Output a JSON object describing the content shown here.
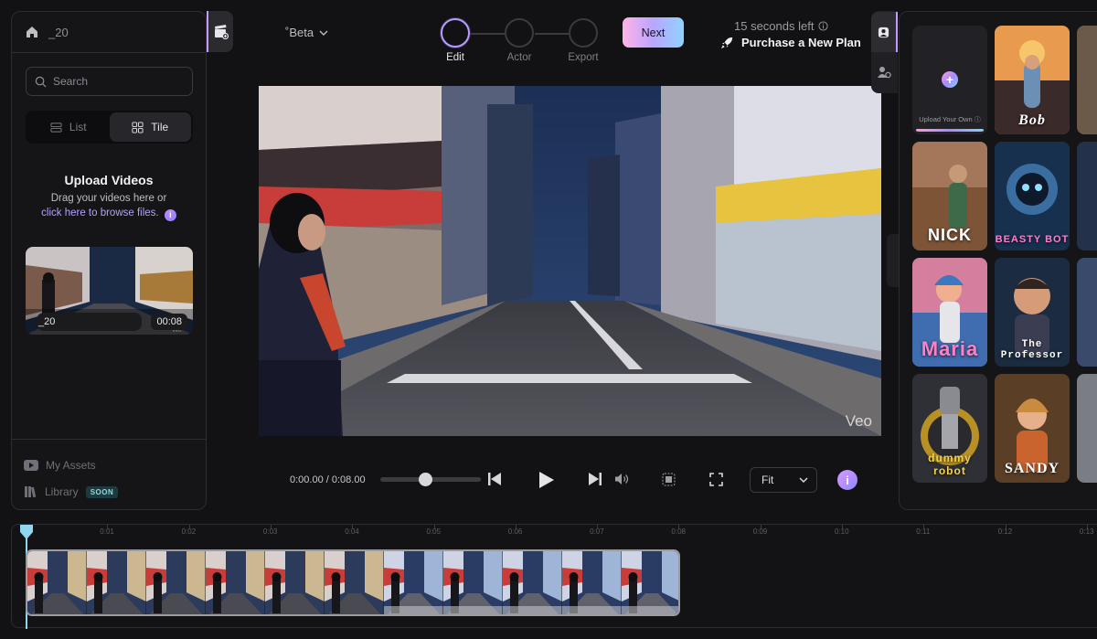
{
  "project": {
    "name": "_20",
    "version": "˚Beta"
  },
  "left_panel": {
    "search_placeholder": "Search",
    "view_list": "List",
    "view_tile": "Tile",
    "upload_title": "Upload Videos",
    "upload_line1": "Drag your videos here or",
    "upload_link": "click here to browse files.",
    "info_glyph": "i",
    "video": {
      "name": "_20",
      "duration": "00:08",
      "watermark": "Veo"
    },
    "my_assets": "My Assets",
    "library": "Library",
    "soon_badge": "SOON"
  },
  "steps": [
    {
      "label": "Edit",
      "active": true
    },
    {
      "label": "Actor",
      "active": false
    },
    {
      "label": "Export",
      "active": false
    }
  ],
  "next_label": "Next",
  "time_left": "15 seconds left",
  "purchase_label": "Purchase a New Plan",
  "preview": {
    "watermark": "Veo"
  },
  "playback": {
    "time": "0:00.00 / 0:08.00",
    "progress": 0.45,
    "fit": "Fit",
    "info": "i"
  },
  "right_panel": {
    "upload_own": "Upload Your Own",
    "actors": [
      {
        "name": "Bob",
        "color_top": "#f0a45a",
        "color_bottom": "#3a2a2a"
      },
      {
        "name": "NICK",
        "color_top": "#8a5a3a",
        "color_bottom": "#2a1c1a"
      },
      {
        "name": "BEASTY BOT",
        "color_top": "#2f6a9a",
        "color_bottom": "#0f1d2e"
      },
      {
        "name": "Maria",
        "color_top": "#c46b8a",
        "color_bottom": "#3a6aa8"
      },
      {
        "name": "The Professor",
        "color_top": "#2a4a6a",
        "color_bottom": "#101822"
      },
      {
        "name": "dummy robot",
        "color_top": "#3a3a3e",
        "color_bottom": "#a88a22"
      },
      {
        "name": "SANDY",
        "color_top": "#7a5a3a",
        "color_bottom": "#3a2a1c"
      }
    ]
  },
  "timeline": {
    "ticks": [
      "0:01",
      "0:02",
      "0:03",
      "0:04",
      "0:05",
      "0:06",
      "0:07",
      "0:08",
      "0:09",
      "0:10",
      "0:11",
      "0:12",
      "0:13"
    ]
  },
  "colors": {
    "accent_purple": "#b89bff",
    "playhead": "#8fd6ee",
    "soon_badge_bg": "#1e3a3e"
  }
}
